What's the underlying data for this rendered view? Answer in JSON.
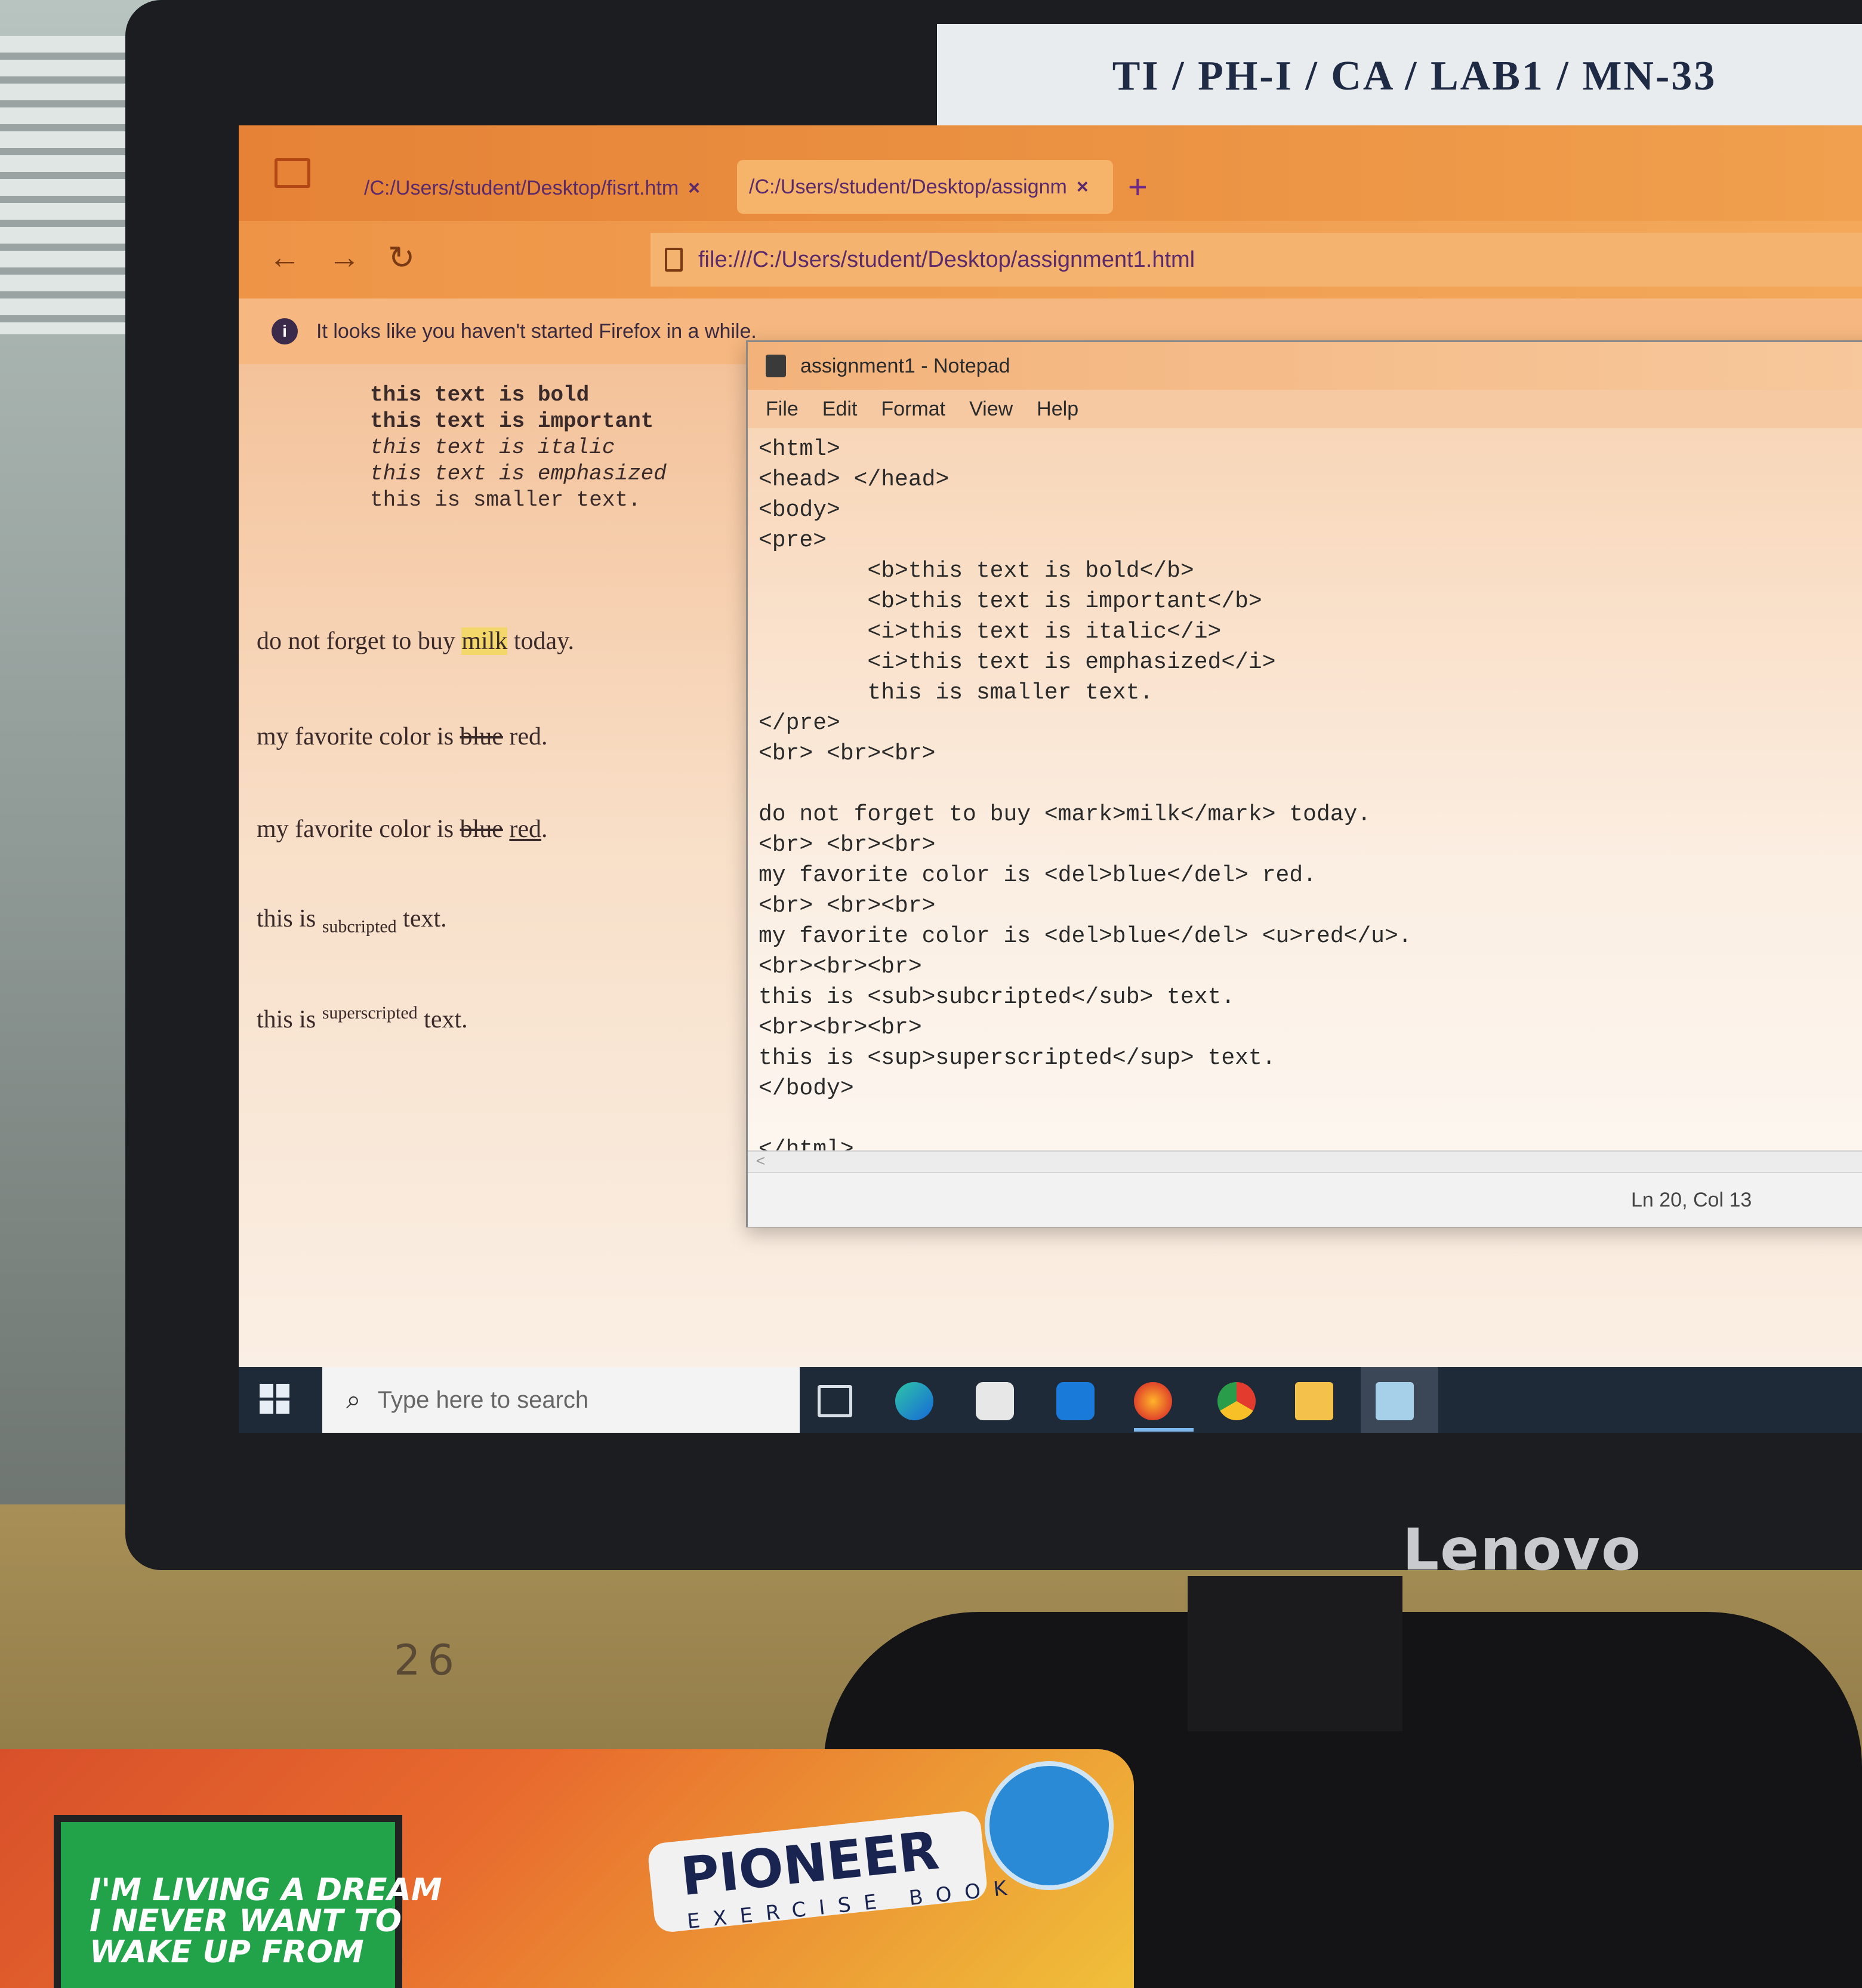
{
  "monitor": {
    "label": "TI / PH-I / CA / LAB1 / MN-33",
    "brand": "Lenovo"
  },
  "browser": {
    "tabs": [
      {
        "label": "/C:/Users/student/Desktop/fisrt.htm",
        "close": "×"
      },
      {
        "label": "/C:/Users/student/Desktop/assignm",
        "close": "×"
      }
    ],
    "new_tab": "+",
    "back": "←",
    "forward": "→",
    "reload": "↻",
    "url": "file:///C:/Users/student/Desktop/assignment1.html",
    "notice": "It looks like you haven't started Firefox in a while.",
    "notice_icon": "i"
  },
  "page": {
    "pre_bold": "this text is bold",
    "pre_important": "this text is important",
    "pre_italic": "this text is italic",
    "pre_emphasized": "this text is emphasized",
    "pre_small": "this is smaller text.",
    "mark_before": "do not forget to buy ",
    "mark_word": "milk",
    "mark_after": " today.",
    "del_before": "my favorite color is ",
    "del_word": "blue",
    "del_after": " red.",
    "u_before": "my favorite color is ",
    "u_del": "blue",
    "u_word": "red",
    "u_after": ".",
    "sub_before": "this is ",
    "sub_word": "subcripted",
    "sub_after": " text.",
    "sup_before": "this is ",
    "sup_word": "superscripted",
    "sup_after": " text."
  },
  "notepad": {
    "title": "assignment1 - Notepad",
    "menu": [
      "File",
      "Edit",
      "Format",
      "View",
      "Help"
    ],
    "lines": [
      "<html>",
      "<head> </head>",
      "<body>",
      "<pre>",
      "        <b>this text is bold</b>",
      "        <b>this text is important</b>",
      "        <i>this text is italic</i>",
      "        <i>this text is emphasized</i>",
      "        this is smaller text.",
      "</pre>",
      "<br> <br><br>",
      "",
      "do not forget to buy <mark>milk</mark> today.",
      "<br> <br><br>",
      "my favorite color is <del>blue</del> red.",
      "<br> <br><br>",
      "my favorite color is <del>blue</del> <u>red</u>.",
      "<br><br><br>",
      "this is <sub>subcripted</sub> text.",
      "<br><br><br>",
      "this is <sup>superscripted</sup> text.",
      "</body>",
      "",
      "</html>"
    ],
    "hscroll": "<",
    "status": "Ln 20, Col 13"
  },
  "taskbar": {
    "search_placeholder": "Type here to search",
    "search_icon": "⌕",
    "icons": [
      "windows-start-icon",
      "task-view-icon",
      "edge-icon",
      "store-icon",
      "mail-icon",
      "firefox-icon",
      "chrome-icon",
      "file-explorer-icon",
      "notepad-icon"
    ]
  },
  "book": {
    "quote": "I'M LIVING A DREAM\nI NEVER WANT TO\nWAKE UP FROM",
    "brand": "PIONEER",
    "subtitle": "EXERCISE BOOK"
  }
}
